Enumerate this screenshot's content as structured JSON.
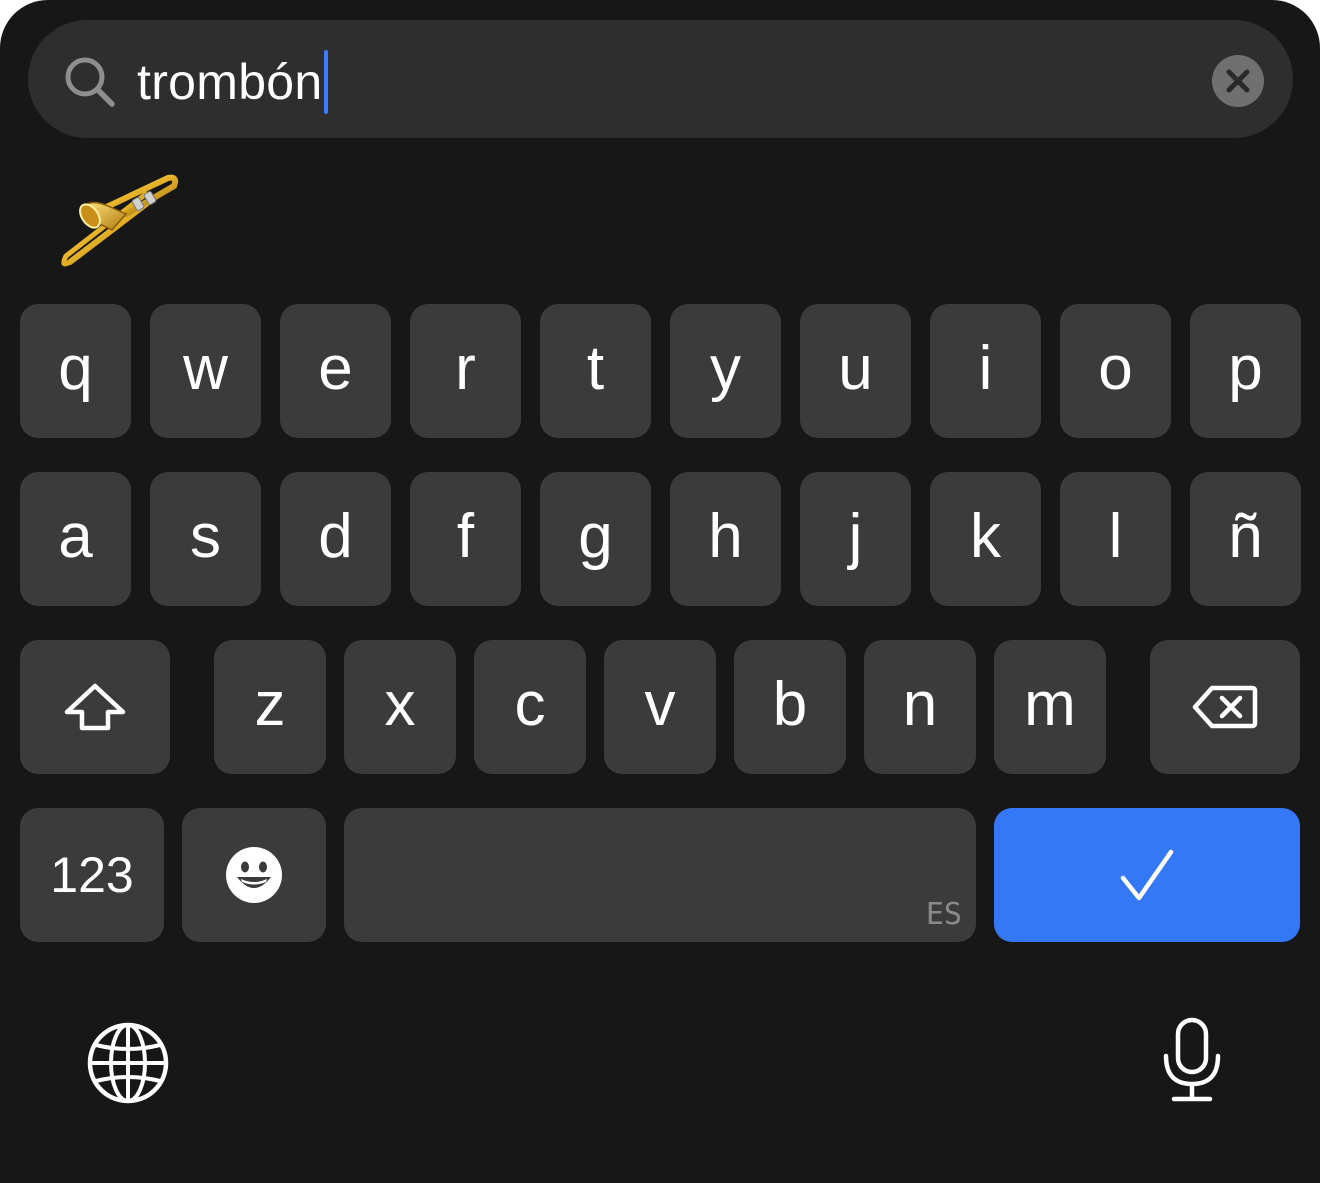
{
  "search": {
    "query": "trombón",
    "clear_icon": "xmark-circle-icon",
    "search_icon": "magnifying-glass-icon"
  },
  "results": [
    {
      "emoji": "trombone",
      "name": "trombone-emoji"
    }
  ],
  "keyboard": {
    "row1": [
      "q",
      "w",
      "e",
      "r",
      "t",
      "y",
      "u",
      "i",
      "o",
      "p"
    ],
    "row2": [
      "a",
      "s",
      "d",
      "f",
      "g",
      "h",
      "j",
      "k",
      "l",
      "ñ"
    ],
    "row3": [
      "z",
      "x",
      "c",
      "v",
      "b",
      "n",
      "m"
    ],
    "numbers_label": "123",
    "space_lang": "ES",
    "shift_icon": "shift-arrow-icon",
    "delete_icon": "delete-backspace-icon",
    "emoji_icon": "smiley-face-icon",
    "done_icon": "checkmark-icon",
    "globe_icon": "globe-icon",
    "mic_icon": "microphone-icon"
  },
  "colors": {
    "background": "#171717",
    "key": "#3b3b3b",
    "search_bar": "#2e2e2e",
    "accent": "#3478f6",
    "caret": "#3a7bff"
  }
}
